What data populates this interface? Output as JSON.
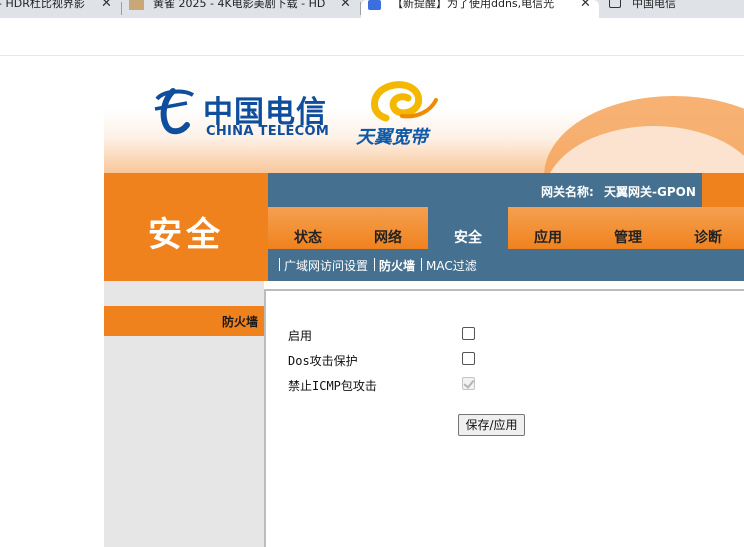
{
  "browser": {
    "tabs": [
      {
        "title": "- HDR杜比视界影",
        "close": "✕"
      },
      {
        "title": "黄雀 2025 - 4K电影美剧下载 - HD",
        "close": "✕"
      },
      {
        "title": "【新提醒】为了使用ddns,电信光",
        "close": "✕"
      },
      {
        "title": "中国电信",
        "close": ""
      }
    ]
  },
  "banner": {
    "logo_cn": "中国电信",
    "logo_en": "CHINA TELECOM",
    "logo_sub": "天翼宽带"
  },
  "header": {
    "section_title": "安全",
    "gateway_label": "网关名称:",
    "gateway_value": "天翼网关-GPON"
  },
  "nav": {
    "tabs": [
      {
        "label": "状态",
        "active": false
      },
      {
        "label": "网络",
        "active": false
      },
      {
        "label": "安全",
        "active": true
      },
      {
        "label": "应用",
        "active": false
      },
      {
        "label": "管理",
        "active": false
      },
      {
        "label": "诊断",
        "active": false
      }
    ],
    "sub_items": [
      {
        "label": "广域网访问设置",
        "active": false
      },
      {
        "label": "防火墙",
        "active": true
      },
      {
        "label": "MAC过滤",
        "active": false
      }
    ]
  },
  "sidebar": {
    "active_item": "防火墙"
  },
  "form": {
    "rows": [
      {
        "label": "启用",
        "checked": false,
        "disabled": false
      },
      {
        "label": "Dos攻击保护",
        "checked": false,
        "disabled": false
      },
      {
        "label": "禁止ICMP包攻击",
        "checked": true,
        "disabled": true
      }
    ],
    "save_label": "保存/应用"
  }
}
